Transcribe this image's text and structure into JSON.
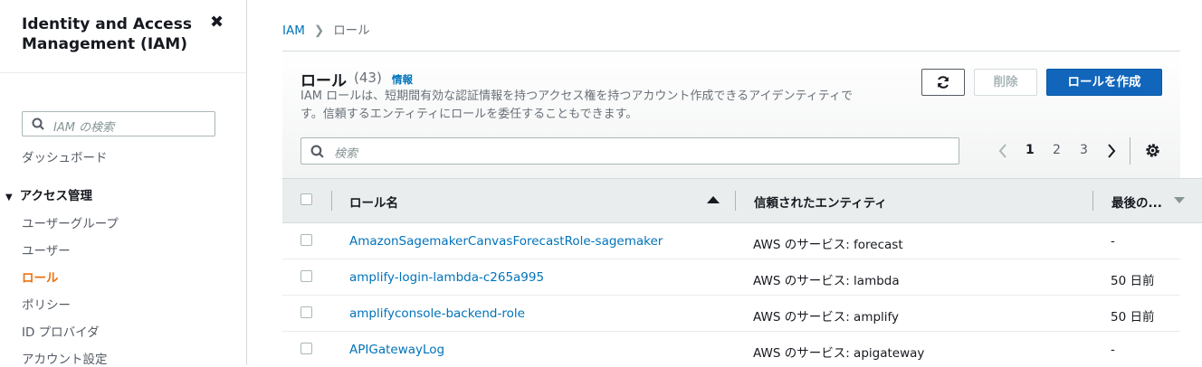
{
  "sidebar": {
    "title": "Identity and Access Management (IAM)",
    "close_icon": "close-icon",
    "search_placeholder": "IAM の検索",
    "dashboard": "ダッシュボード",
    "section_label": "アクセス管理",
    "items": [
      {
        "label": "ユーザーグループ",
        "active": false
      },
      {
        "label": "ユーザー",
        "active": false
      },
      {
        "label": "ロール",
        "active": true
      },
      {
        "label": "ポリシー",
        "active": false
      },
      {
        "label": "ID プロバイダ",
        "active": false
      },
      {
        "label": "アカウント設定",
        "active": false
      }
    ],
    "active_color": "#ec7211"
  },
  "breadcrumb": {
    "root": "IAM",
    "current": "ロール"
  },
  "header": {
    "title": "ロール",
    "count": "(43)",
    "info": "情報",
    "description": "IAM ロールは、短期間有効な認証情報を持つアクセス権を持つアカウント作成できるアイデンティティです。信頼するエンティティにロールを委任することもできます。",
    "refresh_icon": "refresh-icon",
    "delete_label": "削除",
    "create_label": "ロールを作成"
  },
  "search": {
    "placeholder": "検索"
  },
  "pagination": {
    "pages": [
      "1",
      "2",
      "3"
    ],
    "current": "1"
  },
  "table": {
    "columns": [
      "ロール名",
      "信頼されたエンティティ",
      "最後の..."
    ],
    "rows": [
      {
        "name": "AmazonSagemakerCanvasForecastRole-sagemaker",
        "entity": "AWS のサービス: forecast",
        "last": "-"
      },
      {
        "name": "amplify-login-lambda-c265a995",
        "entity": "AWS のサービス: lambda",
        "last": "50 日前"
      },
      {
        "name": "amplifyconsole-backend-role",
        "entity": "AWS のサービス: amplify",
        "last": "50 日前"
      },
      {
        "name": "APIGatewayLog",
        "entity": "AWS のサービス: apigateway",
        "last": "-"
      }
    ]
  },
  "colors": {
    "link": "#0073bb",
    "primary_button": "#1166bb"
  }
}
